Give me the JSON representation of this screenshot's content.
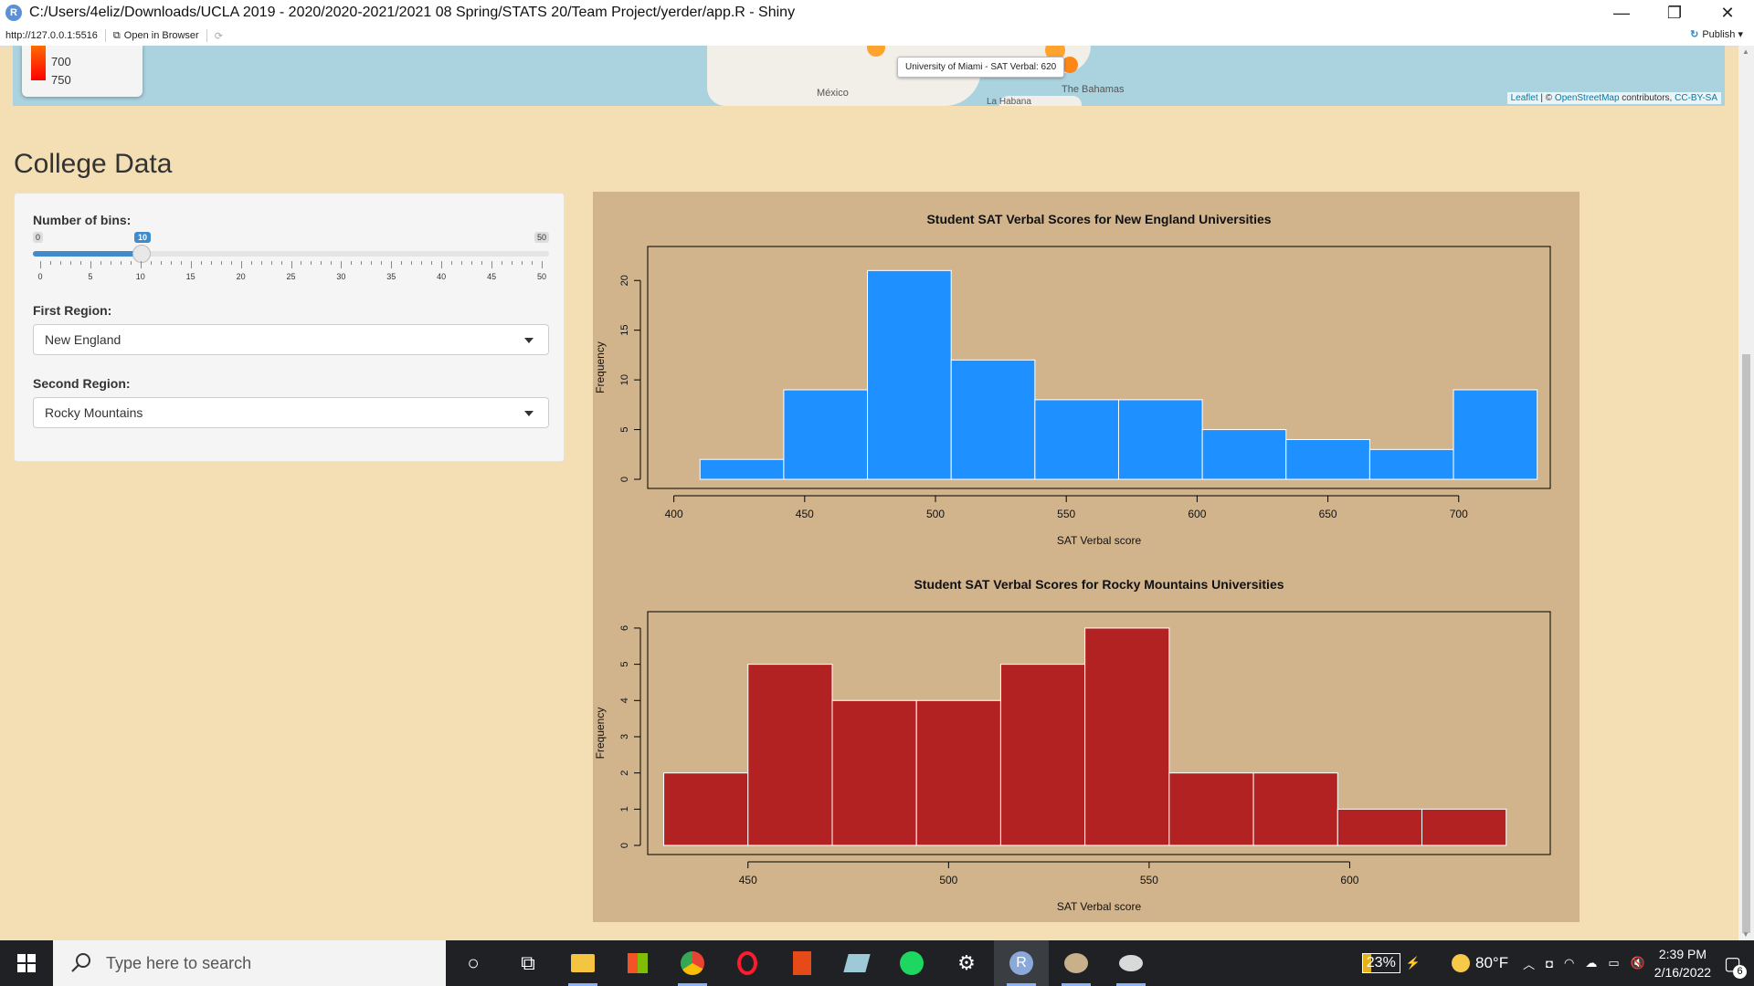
{
  "window": {
    "title": "C:/Users/4eliz/Downloads/UCLA 2019 - 2020/2020-2021/2021 08 Spring/STATS 20/Team Project/yerder/app.R - Shiny",
    "minimize": "—",
    "maximize": "❐",
    "close": "✕"
  },
  "addressbar": {
    "url": "http://127.0.0.1:5516",
    "open_in_browser": "Open in Browser",
    "publish": "Publish"
  },
  "map": {
    "legend": [
      "700",
      "750"
    ],
    "tooltip": "University of Miami - SAT Verbal: 620",
    "labels": [
      "México",
      "The Bahamas",
      "La Habana"
    ],
    "attribution_leaflet": "Leaflet",
    "attribution_sep": " | © ",
    "attribution_osm": "OpenStreetMap",
    "attribution_contrib": " contributors, ",
    "attribution_license": "CC-BY-SA"
  },
  "page": {
    "title": "College Data"
  },
  "controls": {
    "bins": {
      "label": "Number of bins:",
      "min": 0,
      "max": 50,
      "value": 10,
      "ticks": [
        0,
        5,
        10,
        15,
        20,
        25,
        30,
        35,
        40,
        45,
        50
      ]
    },
    "first_region": {
      "label": "First Region:",
      "value": "New England"
    },
    "second_region": {
      "label": "Second Region:",
      "value": "Rocky Mountains"
    }
  },
  "chart_data": [
    {
      "type": "bar",
      "title": "Student SAT Verbal Scores for New England Universities",
      "xlabel": "SAT Verbal score",
      "ylabel": "Frequency",
      "color": "#1e90ff",
      "bin_edges": [
        410,
        442,
        474,
        506,
        538,
        570,
        602,
        634,
        666,
        698,
        730
      ],
      "values": [
        2,
        9,
        21,
        12,
        8,
        8,
        5,
        4,
        3,
        9
      ],
      "xlim": [
        390,
        735
      ],
      "ylim": [
        0,
        22.5
      ],
      "xticks": [
        400,
        450,
        500,
        550,
        600,
        650,
        700
      ],
      "yticks": [
        0,
        5,
        10,
        15,
        20
      ]
    },
    {
      "type": "bar",
      "title": "Student SAT Verbal Scores for Rocky Mountains Universities",
      "xlabel": "SAT Verbal score",
      "ylabel": "Frequency",
      "color": "#b22222",
      "bin_edges": [
        429,
        450,
        471,
        492,
        513,
        534,
        555,
        576,
        597,
        618,
        639
      ],
      "values": [
        2,
        5,
        4,
        4,
        5,
        6,
        2,
        2,
        1,
        1
      ],
      "xlim": [
        425,
        650
      ],
      "ylim": [
        0,
        6.2
      ],
      "xticks": [
        450,
        500,
        550,
        600
      ],
      "yticks": [
        0,
        1,
        2,
        3,
        4,
        5,
        6
      ]
    }
  ],
  "taskbar": {
    "search_placeholder": "Type here to search",
    "battery": "23%",
    "weather": "80°F",
    "time": "2:39 PM",
    "date": "2/16/2022",
    "notifications": "6"
  }
}
